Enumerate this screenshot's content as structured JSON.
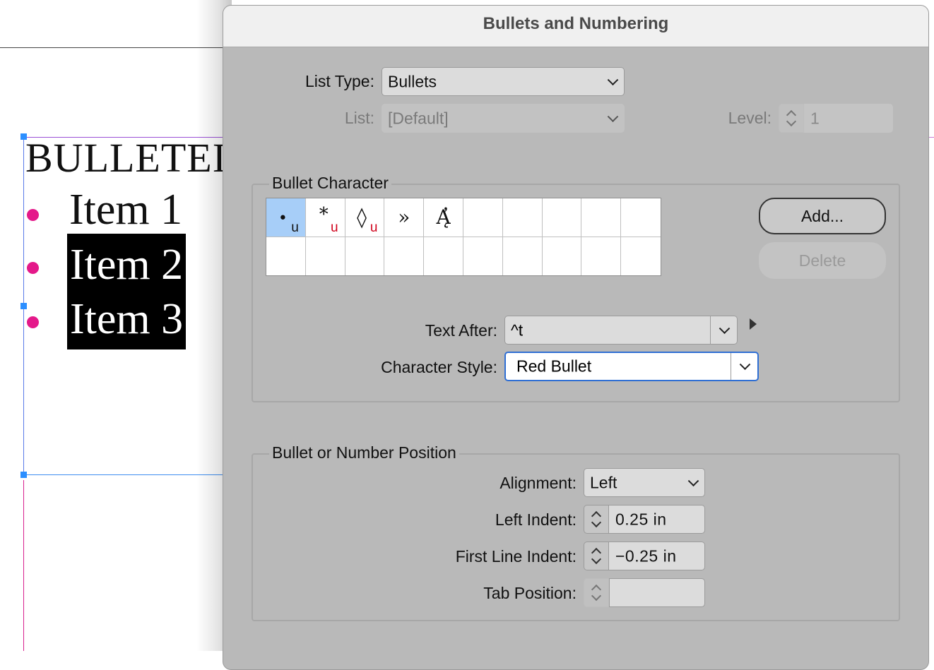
{
  "document": {
    "heading": "BULLETEI",
    "items": [
      "Item 1",
      "Item 2",
      "Item 3"
    ],
    "bullet_color": "#e4198a"
  },
  "dialog": {
    "title": "Bullets and Numbering",
    "list_type": {
      "label": "List Type:",
      "value": "Bullets"
    },
    "list": {
      "label": "List:",
      "value": "[Default]"
    },
    "level": {
      "label": "Level:",
      "value": "1"
    },
    "bullet_character": {
      "group_label": "Bullet Character",
      "glyphs": [
        {
          "char": "•",
          "marker": "u",
          "marker_color": "#111111",
          "selected": true
        },
        {
          "char": "*",
          "marker": "u",
          "marker_color": "#d0021b",
          "selected": false
        },
        {
          "char": "◊",
          "marker": "u",
          "marker_color": "#d0021b",
          "selected": false
        },
        {
          "char": "»",
          "marker": "",
          "marker_color": "",
          "selected": false
        },
        {
          "char": "Ą̓",
          "marker": "",
          "marker_color": "",
          "selected": false
        }
      ],
      "add_button": "Add...",
      "delete_button": "Delete",
      "text_after": {
        "label": "Text After:",
        "value": "^t"
      },
      "character_style": {
        "label": "Character Style:",
        "value": "Red Bullet"
      }
    },
    "position": {
      "group_label": "Bullet or Number Position",
      "alignment": {
        "label": "Alignment:",
        "value": "Left"
      },
      "left_indent": {
        "label": "Left Indent:",
        "value": "0.25 in"
      },
      "first_line_indent": {
        "label": "First Line Indent:",
        "value": "−0.25 in"
      },
      "tab_position": {
        "label": "Tab Position:",
        "value": ""
      }
    }
  },
  "colors": {
    "selection_blue": "#a7cef8",
    "focus_ring": "#2f6fd4",
    "dialog_bg": "#b9b9b9"
  }
}
